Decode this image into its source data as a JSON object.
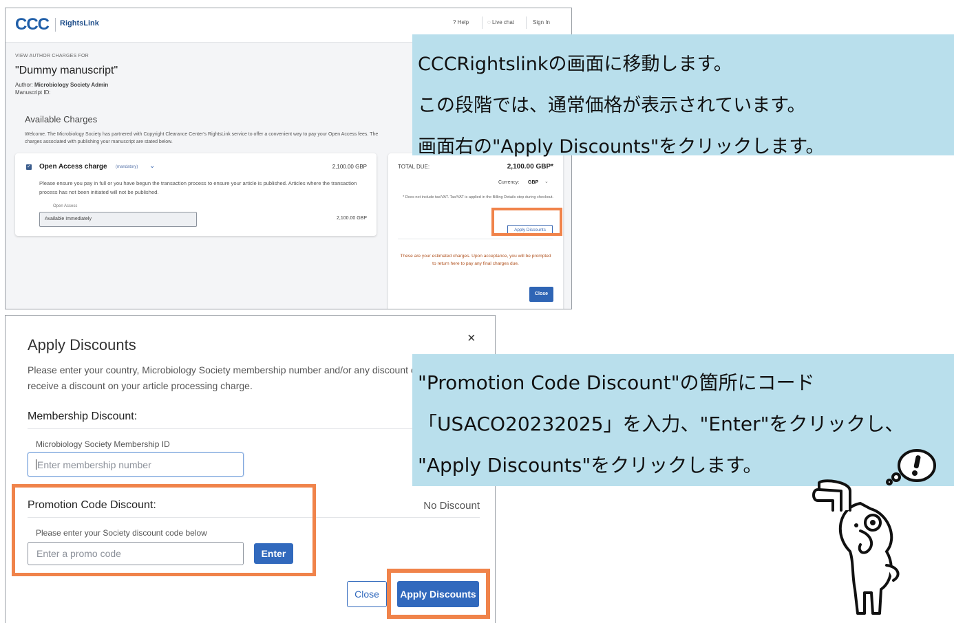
{
  "screen1": {
    "header": {
      "logo_mark": "CCC",
      "logo_text": "RightsLink",
      "links": {
        "help": "? Help",
        "live_chat": "Live chat",
        "sign_in": "Sign In"
      }
    },
    "view_label": "VIEW AUTHOR CHARGES FOR",
    "manuscript_title": "\"Dummy manuscript\"",
    "author_prefix": "Author: ",
    "author_name": "Microbiology Society Admin",
    "manuscript_id_label": "Manuscript ID:",
    "available_title": "Available Charges",
    "welcome_text": "Welcome. The Microbiology Society has partnered with Copyright Clearance Center's RightsLink service to offer a convenient way to pay your Open Access fees. The charges associated with publishing your manuscript are stated below.",
    "charge": {
      "name": "Open Access charge",
      "tag": "(mandatory)",
      "amount": "2,100.00 GBP",
      "description": "Please ensure you pay in full or you have begun the transaction process to ensure your article is published. Articles where the transaction process has not been initiated will not be published.",
      "option_label": "Open Access",
      "option_value": "Available Immediately",
      "option_amount": "2,100.00 GBP"
    },
    "total": {
      "label": "TOTAL DUE:",
      "value": "2,100.00 GBP*",
      "currency_label": "Currency:",
      "currency_value": "GBP",
      "tax_note": "* Does not include tax/VAT. Tax/VAT is applied in the Billing Details step during checkout.",
      "apply_button": "Apply Discounts",
      "estimate_note": "These are your estimated charges. Upon acceptance, you will be prompted to return here to pay any final charges due.",
      "close_button": "Close"
    }
  },
  "callout1": {
    "lines": [
      "CCCRightslinkの画面に移動します。",
      "この段階では、通常価格が表示されています。",
      "画面右の\"Apply Discounts\"をクリックします。"
    ]
  },
  "screen2": {
    "title": "Apply Discounts",
    "close_symbol": "×",
    "description": "Please enter your country, Microbiology Society membership number and/or any discount code to receive a discount on your article processing charge.",
    "membership": {
      "title": "Membership Discount:",
      "label": "Microbiology Society Membership ID",
      "placeholder": "Enter membership number"
    },
    "promotion": {
      "title": "Promotion Code Discount:",
      "status": "No Discount",
      "label": "Please enter your Society discount code below",
      "placeholder": "Enter a promo code",
      "enter_button": "Enter"
    },
    "close_button": "Close",
    "apply_button": "Apply Discounts"
  },
  "callout2": {
    "lines": [
      "\"Promotion Code Discount\"の箇所にコード",
      "「USACO20232025」を入力、\"Enter\"をクリックし、",
      "\"Apply Discounts\"をクリックします。"
    ]
  },
  "colors": {
    "highlight": "#f0834a",
    "callout_bg": "#b9dfec",
    "primary_button": "#3169bd"
  },
  "icons": [
    "check-icon",
    "chevron-down-icon",
    "close-icon",
    "help-icon",
    "chat-icon",
    "mascot-illustration"
  ]
}
